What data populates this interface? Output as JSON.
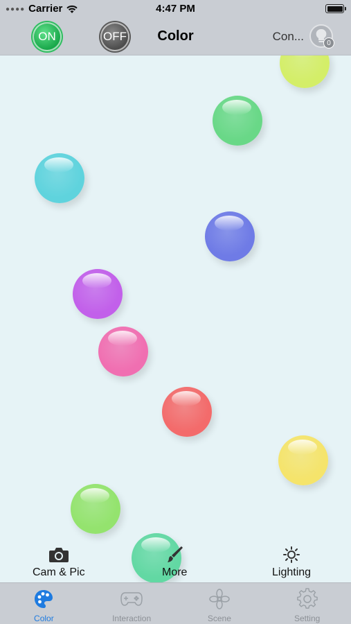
{
  "status_bar": {
    "carrier": "Carrier",
    "time": "4:47 PM"
  },
  "nav": {
    "on_label": "ON",
    "off_label": "OFF",
    "title": "Color",
    "connect_label": "Con...",
    "device_count": "0"
  },
  "colors": {
    "accent": "#1e7be0",
    "on_green": "#1aa84b",
    "bar_gray": "#c9cdd3"
  },
  "balls": [
    {
      "name": "yellow-green",
      "color": "#d4ee68"
    },
    {
      "name": "green",
      "color": "#69d887"
    },
    {
      "name": "cyan",
      "color": "#5fd3dd"
    },
    {
      "name": "blue",
      "color": "#6f7be6"
    },
    {
      "name": "purple",
      "color": "#c260ea"
    },
    {
      "name": "pink",
      "color": "#f06fb1"
    },
    {
      "name": "red",
      "color": "#f36b6b"
    },
    {
      "name": "yellow",
      "color": "#f5e46b"
    },
    {
      "name": "light-green",
      "color": "#94e36e"
    },
    {
      "name": "teal-green",
      "color": "#62d8a3"
    }
  ],
  "actions": {
    "cam_label": "Cam & Pic",
    "more_label": "More",
    "lighting_label": "Lighting"
  },
  "tabs": [
    {
      "label": "Color",
      "icon": "palette-icon",
      "active": true
    },
    {
      "label": "Interaction",
      "icon": "gamepad-icon",
      "active": false
    },
    {
      "label": "Scene",
      "icon": "flower-icon",
      "active": false
    },
    {
      "label": "Setting",
      "icon": "gear-icon",
      "active": false
    }
  ]
}
